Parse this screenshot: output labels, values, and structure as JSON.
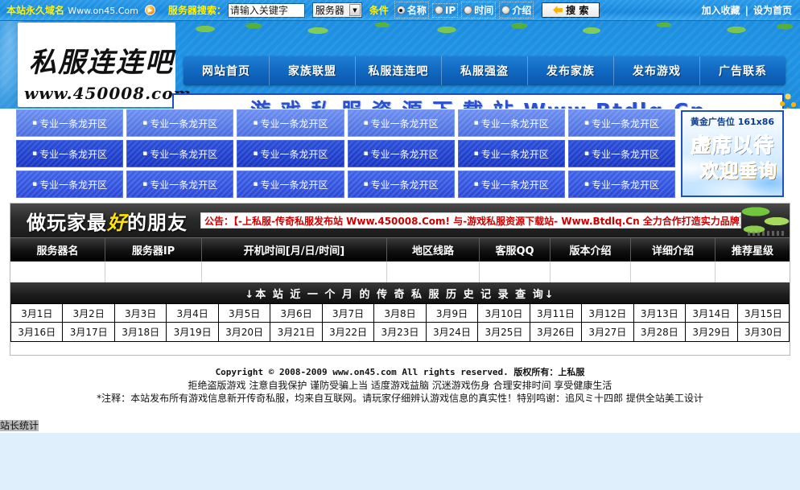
{
  "topbar": {
    "domain_label": "本站永久域名",
    "domain_url": "Www.on45.Com",
    "orb_icon": "play-orb-icon",
    "search_label": "服务器搜索：",
    "search_value": "请输入关键字",
    "search_placeholder": "请输入关键字",
    "select_value": "服务器",
    "condition_label": "条件",
    "radios": [
      {
        "label": "名称",
        "checked": true
      },
      {
        "label": "IP",
        "checked": false
      },
      {
        "label": "时间",
        "checked": false
      },
      {
        "label": "介绍",
        "checked": false
      }
    ],
    "search_button": "搜 索",
    "search_button_icon": "back-arrow-icon",
    "favorite_link": "加入收藏",
    "separator": "|",
    "homepage_link": "设为首页"
  },
  "header": {
    "logo_cn": "私服连连吧",
    "logo_url": "www.450008.com",
    "nav": [
      "网站首页",
      "家族联盟",
      "私服连连吧",
      "私服强盗",
      "发布家族",
      "发布游戏",
      "广告联系"
    ],
    "banner_text": "游 戏 私 服 资 源 下 载 站 Www.Btdlq.Cn"
  },
  "ads": {
    "cell_label": "专业一条龙开区",
    "bullet": "▪",
    "cells": [
      "专业一条龙开区",
      "专业一条龙开区",
      "专业一条龙开区",
      "专业一条龙开区",
      "专业一条龙开区",
      "专业一条龙开区",
      "专业一条龙开区",
      "专业一条龙开区",
      "专业一条龙开区",
      "专业一条龙开区",
      "专业一条龙开区",
      "专业一条龙开区",
      "专业一条龙开区",
      "专业一条龙开区",
      "专业一条龙开区",
      "专业一条龙开区",
      "专业一条龙开区",
      "专业一条龙开区"
    ],
    "box": {
      "title": "黄金广告位 161x86",
      "line1_a": "虚",
      "line1_b": "席以待",
      "line2": "欢迎垂询"
    }
  },
  "notice": {
    "slogan_a": "做玩家最",
    "slogan_hl": "好",
    "slogan_b": "的朋友",
    "text": "公告：【-上私服-传奇私服发布站 Www.450008.Com! 与-游戏私服资源下载站- Www.Btdlq.Cn 全力合作打造实力品牌】"
  },
  "table": {
    "headers": [
      "服务器名",
      "服务器IP",
      "开机时间[月/日/时间]",
      "地区线路",
      "客服QQ",
      "版本介绍",
      "详细介绍",
      "推荐星级"
    ],
    "rows": []
  },
  "query": {
    "title": "↓本 站 近 一 个 月 的 传 奇 私 服 历 史 记 录 查 询↓",
    "dates": [
      "3月1日",
      "3月2日",
      "3月3日",
      "3月4日",
      "3月5日",
      "3月6日",
      "3月7日",
      "3月8日",
      "3月9日",
      "3月10日",
      "3月11日",
      "3月12日",
      "3月13日",
      "3月14日",
      "3月15日",
      "3月16日",
      "3月17日",
      "3月18日",
      "3月19日",
      "3月20日",
      "3月21日",
      "3月22日",
      "3月23日",
      "3月24日",
      "3月25日",
      "3月26日",
      "3月27日",
      "3月28日",
      "3月29日",
      "3月30日"
    ]
  },
  "footer": {
    "copyright": "Copyright © 2008-2009 www.on45.com All rights reserved.  版权所有：上私服",
    "slogan": "拒绝盗版游戏 注意自我保护 谨防受骗上当 适度游戏益脑 沉迷游戏伤身 合理安排时间 享受健康生活",
    "note": "*注释：本站发布所有游戏信息新开传奇私服，均来自互联网。请玩家仔细辨认游戏信息的真实性！特别鸣谢：追风ミ十四郎 提供全站美工设计",
    "status": "站长统计"
  },
  "colors": {
    "topbar_blue": "#1f90e2",
    "nav_blue": "#1168c0",
    "banner_text": "#2b4fd4",
    "notice_red": "#cc0000",
    "highlight_yellow": "#ffe400",
    "ad_gold": "#f0a500"
  }
}
